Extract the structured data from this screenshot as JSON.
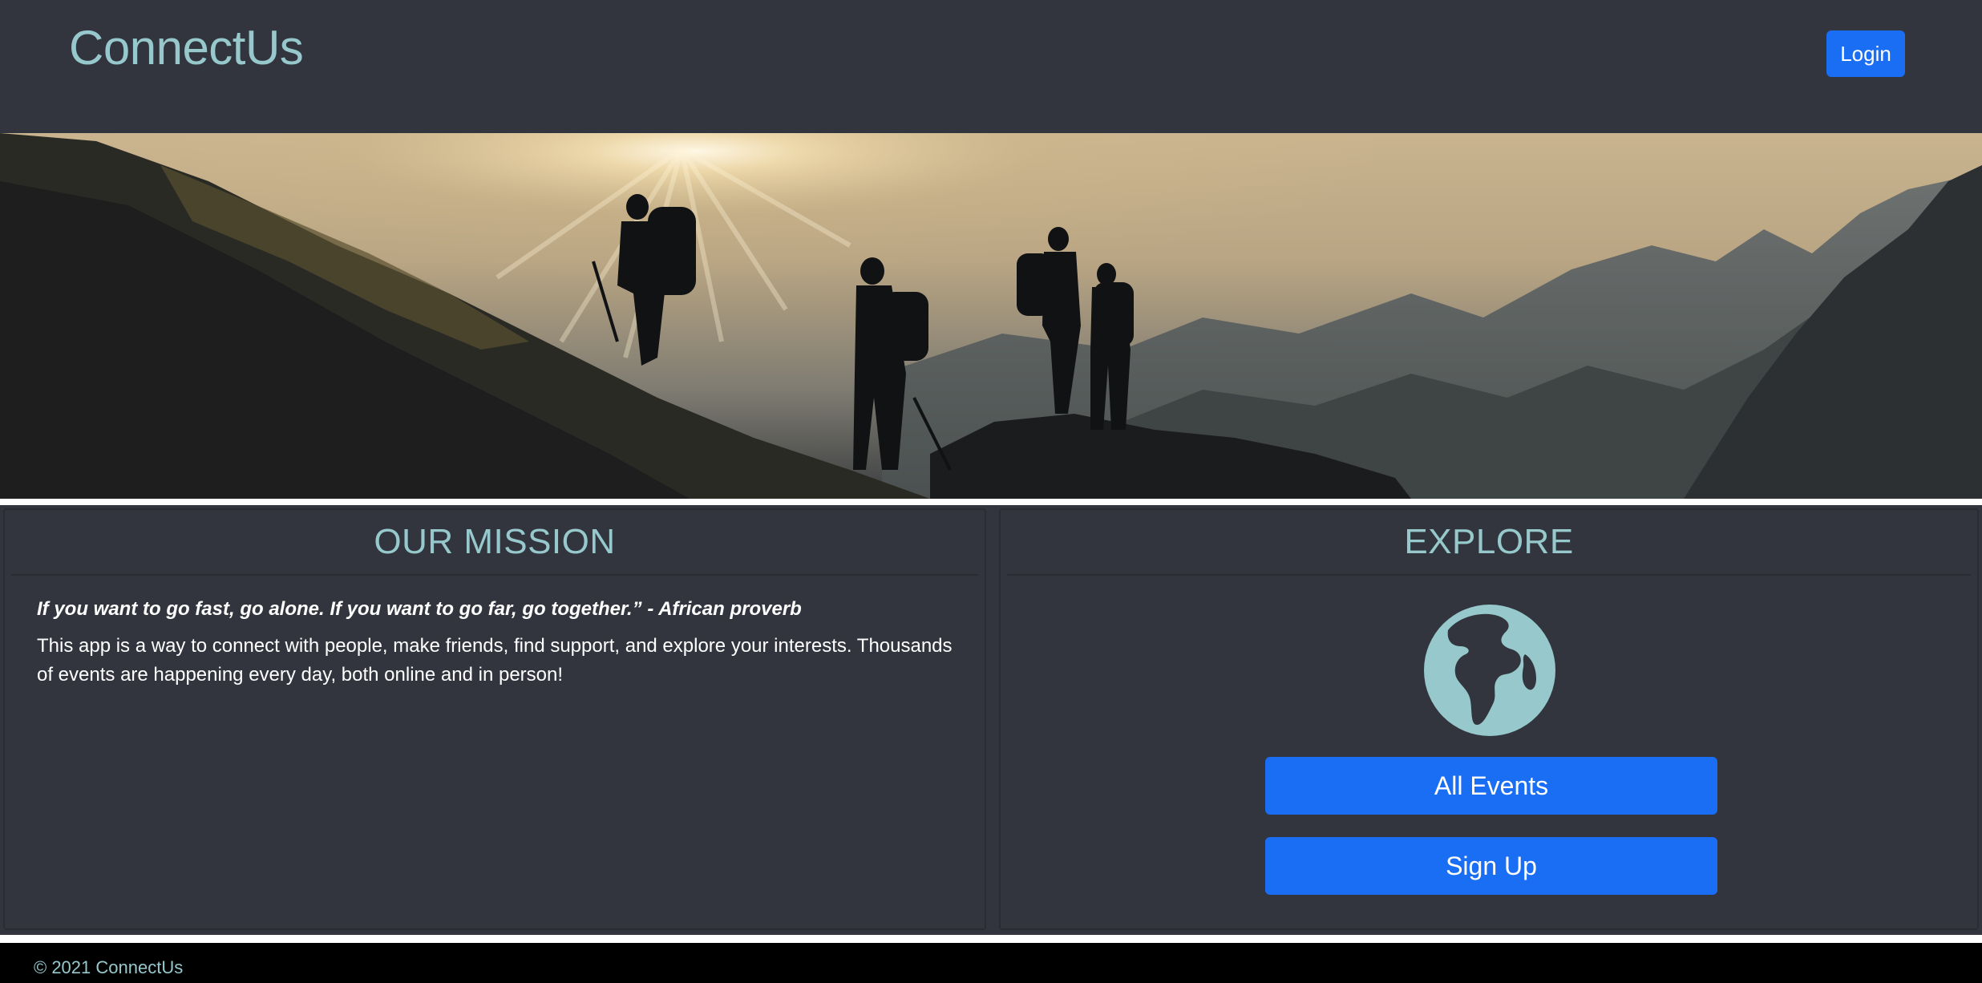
{
  "header": {
    "brand": "ConnectUs",
    "login_label": "Login"
  },
  "hero": {
    "image": "hikers-silhouette-mountain-sunrise"
  },
  "mission": {
    "title": "OUR MISSION",
    "quote": "If you want to go fast, go alone. If you want to go far, go together.” - African proverb",
    "text": "This app is a way to connect with people, make friends, find support, and explore your interests. Thousands of events are happening every day, both online and in person!"
  },
  "explore": {
    "title": "EXPLORE",
    "icon": "globe-icon",
    "all_events_label": "All Events",
    "sign_up_label": "Sign Up"
  },
  "footer": {
    "copyright": "© 2021 ConnectUs"
  },
  "colors": {
    "accent": "#96c8cc",
    "button": "#1a6ef4",
    "panel": "#32353e"
  }
}
